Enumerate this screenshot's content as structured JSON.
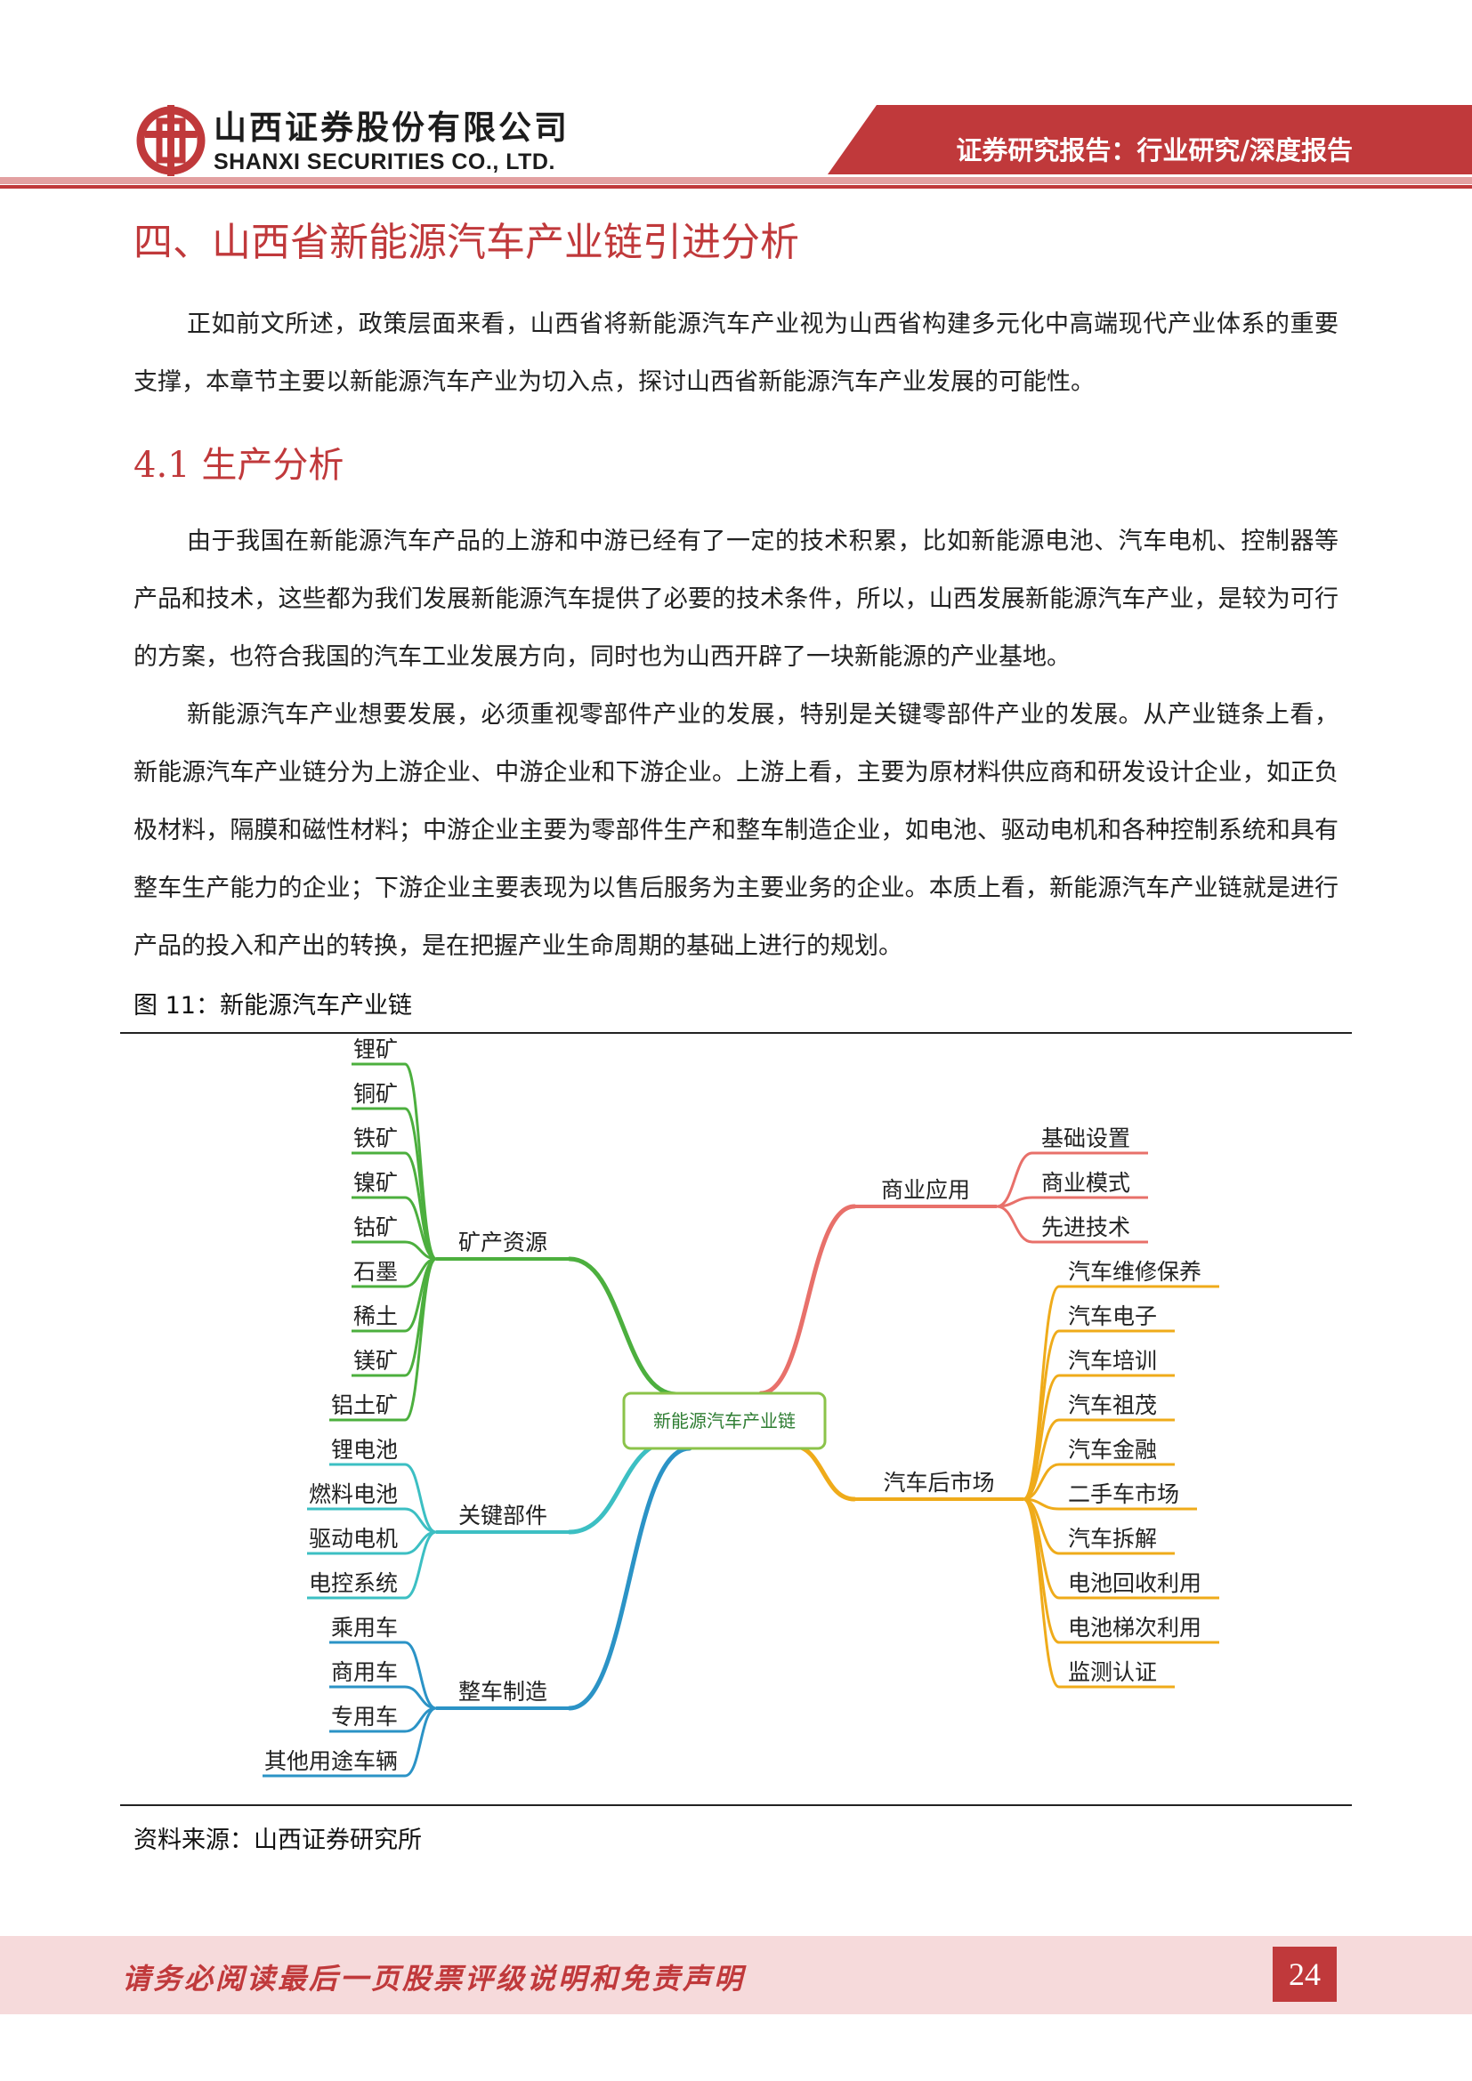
{
  "header": {
    "company_cn": "山西证券股份有限公司",
    "company_en": "SHANXI SECURITIES CO., LTD.",
    "report_type": "证券研究报告：行业研究/深度报告",
    "accent_color": "#c0393b"
  },
  "section": {
    "title": "四、山西省新能源汽车产业链引进分析",
    "intro": "正如前文所述，政策层面来看，山西省将新能源汽车产业视为山西省构建多元化中高端现代产业体系的重要支撑，本章节主要以新能源汽车产业为切入点，探讨山西省新能源汽车产业发展的可能性。"
  },
  "subsection": {
    "title": "4.1  生产分析",
    "para1": "由于我国在新能源汽车产品的上游和中游已经有了一定的技术积累，比如新能源电池、汽车电机、控制器等产品和技术，这些都为我们发展新能源汽车提供了必要的技术条件，所以，山西发展新能源汽车产业，是较为可行的方案，也符合我国的汽车工业发展方向，同时也为山西开辟了一块新能源的产业基地。",
    "para2": "新能源汽车产业想要发展，必须重视零部件产业的发展，特别是关键零部件产业的发展。从产业链条上看，新能源汽车产业链分为上游企业、中游企业和下游企业。上游上看，主要为原材料供应商和研发设计企业，如正负极材料，隔膜和磁性材料；中游企业主要为零部件生产和整车制造企业，如电池、驱动电机和各种控制系统和具有整车生产能力的企业；下游企业主要表现为以售后服务为主要业务的企业。本质上看，新能源汽车产业链就是进行产品的投入和产出的转换，是在把握产业生命周期的基础上进行的规划。"
  },
  "figure": {
    "title": "图 11：新能源汽车产业链",
    "source": "资料来源：山西证券研究所",
    "center": "新能源汽车产业链",
    "branches": [
      {
        "label": "矿产资源",
        "color": "#4caf3e",
        "leaves": [
          "锂矿",
          "铜矿",
          "铁矿",
          "镍矿",
          "钴矿",
          "石墨",
          "稀土",
          "镁矿",
          "铝土矿"
        ]
      },
      {
        "label": "关键部件",
        "color": "#3cbfc3",
        "leaves": [
          "锂电池",
          "燃料电池",
          "驱动电机",
          "电控系统"
        ]
      },
      {
        "label": "整车制造",
        "color": "#2b93c6",
        "leaves": [
          "乘用车",
          "商用车",
          "专用车",
          "其他用途车辆"
        ]
      },
      {
        "label": "商业应用",
        "color": "#e8706a",
        "leaves": [
          "基础设置",
          "商业模式",
          "先进技术"
        ]
      },
      {
        "label": "汽车后市场",
        "color": "#efab1a",
        "leaves": [
          "汽车维修保养",
          "汽车电子",
          "汽车培训",
          "汽车祖茂",
          "汽车金融",
          "二手车市场",
          "汽车拆解",
          "电池回收利用",
          "电池梯次利用",
          "监测认证"
        ]
      }
    ]
  },
  "footer": {
    "disclaimer": "请务必阅读最后一页股票评级说明和免责声明",
    "page_number": "24"
  }
}
